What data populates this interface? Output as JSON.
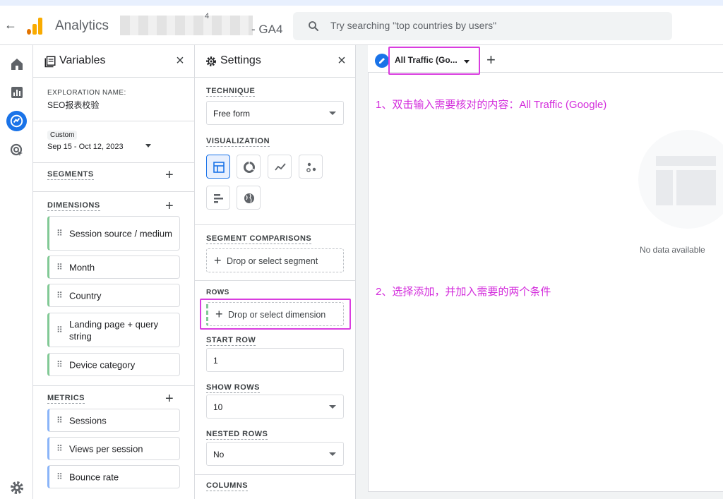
{
  "header": {
    "back_icon": "arrow-left-icon",
    "app_title": "Analytics",
    "account_hint": "4",
    "property_suffix": "- GA4",
    "search_placeholder": "Try searching \"top countries by users\""
  },
  "rail": {
    "items": [
      "home-icon",
      "reports-icon",
      "explore-icon",
      "advertising-icon"
    ],
    "settings": "gear-icon"
  },
  "variables": {
    "title": "Variables",
    "exploration_label": "EXPLORATION NAME:",
    "exploration_name": "SEO报表校验",
    "date_badge": "Custom",
    "date_range": "Sep 15 - Oct 12, 2023",
    "segments_label": "SEGMENTS",
    "dimensions_label": "DIMENSIONS",
    "dimensions": [
      "Session source / medium",
      "Month",
      "Country",
      "Landing page + query string",
      "Device category"
    ],
    "metrics_label": "METRICS",
    "metrics": [
      "Sessions",
      "Views per session",
      "Bounce rate"
    ]
  },
  "settings": {
    "title": "Settings",
    "technique_label": "TECHNIQUE",
    "technique_value": "Free form",
    "visualization_label": "VISUALIZATION",
    "visualizations": [
      "table-icon",
      "donut-chart-icon",
      "line-chart-icon",
      "scatter-chart-icon",
      "bar-chart-icon",
      "geo-map-icon"
    ],
    "segment_comparisons_label": "SEGMENT COMPARISONS",
    "segment_drop": "Drop or select segment",
    "rows_label": "ROWS",
    "rows_drop": "Drop or select dimension",
    "start_row_label": "START ROW",
    "start_row_value": "1",
    "show_rows_label": "SHOW ROWS",
    "show_rows_value": "10",
    "nested_rows_label": "NESTED ROWS",
    "nested_rows_value": "No",
    "columns_label": "COLUMNS"
  },
  "canvas": {
    "tab_label": "All Traffic (Go...",
    "no_data": "No data available",
    "annotation_1": "1、双击输入需要核对的内容：All Traffic (Google)",
    "annotation_2": "2、选择添加，并加入需要的两个条件"
  },
  "colors": {
    "accent": "#1a73e8",
    "annotation": "#d32cdc",
    "dimension_bar": "#81c995",
    "metric_bar": "#8ab4f8"
  }
}
